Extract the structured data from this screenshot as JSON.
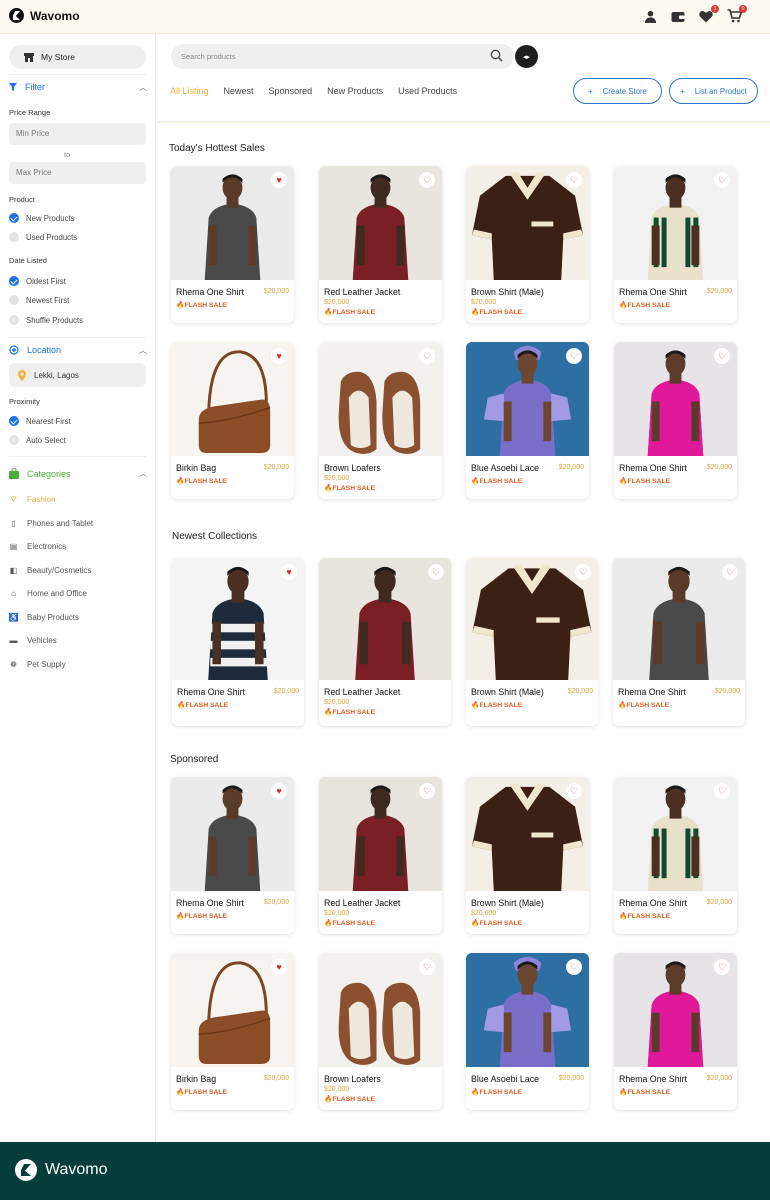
{
  "app": {
    "name": "Wavomo"
  },
  "header": {
    "wishlist_count": "1",
    "cart_count": "0"
  },
  "sidebar": {
    "my_store": "My Store",
    "filter_title": "Filter",
    "price_range": "Price Range",
    "min_price": "Min Price",
    "to": "to",
    "max_price": "Max Price",
    "product_label": "Product",
    "product_options": [
      "New Products",
      "Used Products"
    ],
    "date_label": "Date Listed",
    "date_options": [
      "Oldest First",
      "Newest First",
      "Shuffle Products"
    ],
    "location_title": "Location",
    "location_value": "Lekki, Lagos",
    "proximity_label": "Proximity",
    "proximity_options": [
      "Nearest First",
      "Auto Select"
    ],
    "categories_title": "Categories",
    "categories": [
      "Fashion",
      "Phones and Tablet",
      "Electronics",
      "Beauty/Cosmetics",
      "Home and Office",
      "Baby Products",
      "Vehicles",
      "Pet Supply"
    ]
  },
  "search": {
    "placeholder": "Search products"
  },
  "tabs": [
    "All Listing",
    "Newest",
    "Sponsored",
    "New Products",
    "Used Products"
  ],
  "buttons": {
    "create_store": "Create Store",
    "list_product": "List an Product"
  },
  "sections": {
    "hottest": "Today's Hottest Sales",
    "newest": "Newest Collections",
    "sponsored": "Sponsored"
  },
  "flash": "🔥FLASH SALE",
  "products": {
    "row1": [
      {
        "name": "Rhema One Shirt",
        "price": "$20,000"
      },
      {
        "name": "Red Leather Jacket",
        "price": "$20,000"
      },
      {
        "name": "Brown Shirt (Male)",
        "price": "$20,000"
      },
      {
        "name": "Rhema One Shirt",
        "price": "$20,000"
      }
    ],
    "row2": [
      {
        "name": "Birkin Bag",
        "price": "$20,000"
      },
      {
        "name": "Brown Loafers",
        "price": "$20,000"
      },
      {
        "name": "Blue Asoebi Lace",
        "price": "$20,000"
      },
      {
        "name": "Rhema One Shirt",
        "price": "$20,000"
      }
    ],
    "row3": [
      {
        "name": "Rhema One Shirt",
        "price": "$20,000"
      },
      {
        "name": "Red Leather Jacket",
        "price": "$20,000"
      },
      {
        "name": "Brown Shirt (Male)",
        "price": "$20,000"
      },
      {
        "name": "Rhema One Shirt",
        "price": "$20,000"
      }
    ],
    "row4": [
      {
        "name": "Rhema One Shirt",
        "price": "$20,000"
      },
      {
        "name": "Red Leather Jacket",
        "price": "$20,000"
      },
      {
        "name": "Brown Shirt (Male)",
        "price": "$20,000"
      },
      {
        "name": "Rhema One Shirt",
        "price": "$20,000"
      }
    ],
    "row5": [
      {
        "name": "Birkin Bag",
        "price": "$20,000"
      },
      {
        "name": "Brown Loafers",
        "price": "$20,000"
      },
      {
        "name": "Blue Asoebi Lace",
        "price": "$20,000"
      },
      {
        "name": "Rhema One Shirt",
        "price": "$20,000"
      }
    ]
  },
  "colors": {
    "accent": "#f3b13b",
    "brand_blue": "#1a73e8",
    "flash": "#e55c1a",
    "footer": "#053d3a"
  }
}
